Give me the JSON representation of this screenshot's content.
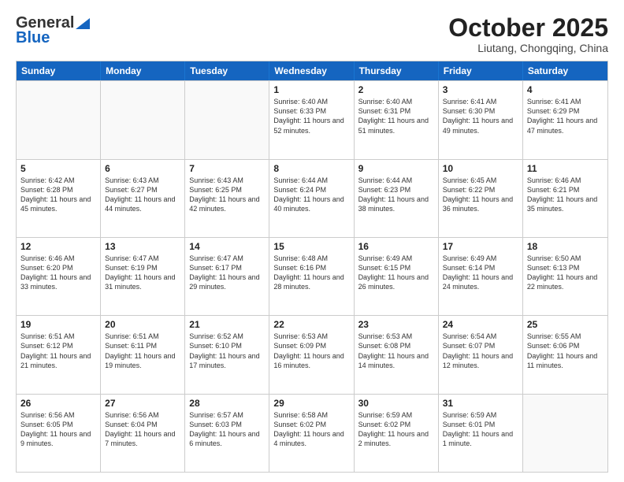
{
  "header": {
    "logo_general": "General",
    "logo_blue": "Blue",
    "month": "October 2025",
    "location": "Liutang, Chongqing, China"
  },
  "days_of_week": [
    "Sunday",
    "Monday",
    "Tuesday",
    "Wednesday",
    "Thursday",
    "Friday",
    "Saturday"
  ],
  "rows": [
    [
      {
        "day": "",
        "text": ""
      },
      {
        "day": "",
        "text": ""
      },
      {
        "day": "",
        "text": ""
      },
      {
        "day": "1",
        "text": "Sunrise: 6:40 AM\nSunset: 6:33 PM\nDaylight: 11 hours and 52 minutes."
      },
      {
        "day": "2",
        "text": "Sunrise: 6:40 AM\nSunset: 6:31 PM\nDaylight: 11 hours and 51 minutes."
      },
      {
        "day": "3",
        "text": "Sunrise: 6:41 AM\nSunset: 6:30 PM\nDaylight: 11 hours and 49 minutes."
      },
      {
        "day": "4",
        "text": "Sunrise: 6:41 AM\nSunset: 6:29 PM\nDaylight: 11 hours and 47 minutes."
      }
    ],
    [
      {
        "day": "5",
        "text": "Sunrise: 6:42 AM\nSunset: 6:28 PM\nDaylight: 11 hours and 45 minutes."
      },
      {
        "day": "6",
        "text": "Sunrise: 6:43 AM\nSunset: 6:27 PM\nDaylight: 11 hours and 44 minutes."
      },
      {
        "day": "7",
        "text": "Sunrise: 6:43 AM\nSunset: 6:25 PM\nDaylight: 11 hours and 42 minutes."
      },
      {
        "day": "8",
        "text": "Sunrise: 6:44 AM\nSunset: 6:24 PM\nDaylight: 11 hours and 40 minutes."
      },
      {
        "day": "9",
        "text": "Sunrise: 6:44 AM\nSunset: 6:23 PM\nDaylight: 11 hours and 38 minutes."
      },
      {
        "day": "10",
        "text": "Sunrise: 6:45 AM\nSunset: 6:22 PM\nDaylight: 11 hours and 36 minutes."
      },
      {
        "day": "11",
        "text": "Sunrise: 6:46 AM\nSunset: 6:21 PM\nDaylight: 11 hours and 35 minutes."
      }
    ],
    [
      {
        "day": "12",
        "text": "Sunrise: 6:46 AM\nSunset: 6:20 PM\nDaylight: 11 hours and 33 minutes."
      },
      {
        "day": "13",
        "text": "Sunrise: 6:47 AM\nSunset: 6:19 PM\nDaylight: 11 hours and 31 minutes."
      },
      {
        "day": "14",
        "text": "Sunrise: 6:47 AM\nSunset: 6:17 PM\nDaylight: 11 hours and 29 minutes."
      },
      {
        "day": "15",
        "text": "Sunrise: 6:48 AM\nSunset: 6:16 PM\nDaylight: 11 hours and 28 minutes."
      },
      {
        "day": "16",
        "text": "Sunrise: 6:49 AM\nSunset: 6:15 PM\nDaylight: 11 hours and 26 minutes."
      },
      {
        "day": "17",
        "text": "Sunrise: 6:49 AM\nSunset: 6:14 PM\nDaylight: 11 hours and 24 minutes."
      },
      {
        "day": "18",
        "text": "Sunrise: 6:50 AM\nSunset: 6:13 PM\nDaylight: 11 hours and 22 minutes."
      }
    ],
    [
      {
        "day": "19",
        "text": "Sunrise: 6:51 AM\nSunset: 6:12 PM\nDaylight: 11 hours and 21 minutes."
      },
      {
        "day": "20",
        "text": "Sunrise: 6:51 AM\nSunset: 6:11 PM\nDaylight: 11 hours and 19 minutes."
      },
      {
        "day": "21",
        "text": "Sunrise: 6:52 AM\nSunset: 6:10 PM\nDaylight: 11 hours and 17 minutes."
      },
      {
        "day": "22",
        "text": "Sunrise: 6:53 AM\nSunset: 6:09 PM\nDaylight: 11 hours and 16 minutes."
      },
      {
        "day": "23",
        "text": "Sunrise: 6:53 AM\nSunset: 6:08 PM\nDaylight: 11 hours and 14 minutes."
      },
      {
        "day": "24",
        "text": "Sunrise: 6:54 AM\nSunset: 6:07 PM\nDaylight: 11 hours and 12 minutes."
      },
      {
        "day": "25",
        "text": "Sunrise: 6:55 AM\nSunset: 6:06 PM\nDaylight: 11 hours and 11 minutes."
      }
    ],
    [
      {
        "day": "26",
        "text": "Sunrise: 6:56 AM\nSunset: 6:05 PM\nDaylight: 11 hours and 9 minutes."
      },
      {
        "day": "27",
        "text": "Sunrise: 6:56 AM\nSunset: 6:04 PM\nDaylight: 11 hours and 7 minutes."
      },
      {
        "day": "28",
        "text": "Sunrise: 6:57 AM\nSunset: 6:03 PM\nDaylight: 11 hours and 6 minutes."
      },
      {
        "day": "29",
        "text": "Sunrise: 6:58 AM\nSunset: 6:02 PM\nDaylight: 11 hours and 4 minutes."
      },
      {
        "day": "30",
        "text": "Sunrise: 6:59 AM\nSunset: 6:02 PM\nDaylight: 11 hours and 2 minutes."
      },
      {
        "day": "31",
        "text": "Sunrise: 6:59 AM\nSunset: 6:01 PM\nDaylight: 11 hours and 1 minute."
      },
      {
        "day": "",
        "text": ""
      }
    ]
  ]
}
